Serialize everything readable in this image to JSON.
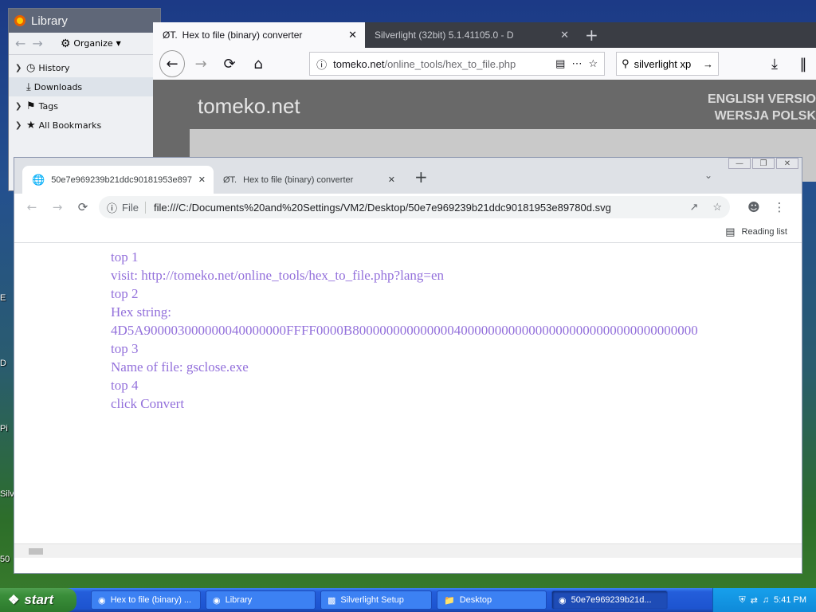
{
  "desktop": {
    "fragments": [
      "E",
      "D",
      "Pi",
      "Silv",
      "50"
    ]
  },
  "library_window": {
    "title": "Library",
    "toolbar": {
      "organize_label": "Organize"
    },
    "tree": [
      {
        "label": "History"
      },
      {
        "label": "Downloads"
      },
      {
        "label": "Tags"
      },
      {
        "label": "All Bookmarks"
      }
    ]
  },
  "firefox_window": {
    "tabs": [
      {
        "label": "Hex to file (binary) converter",
        "favicon": "ØT."
      },
      {
        "label": "Silverlight (32bit) 5.1.41105.0 - D"
      }
    ],
    "url": {
      "domain": "tomeko.net",
      "path": "/online_tools/hex_to_file.php"
    },
    "search_value": "silverlight xp",
    "page": {
      "logo": "tomeko.net",
      "lang_english": "ENGLISH VERSIO",
      "lang_polish": "WERSJA POLSK"
    }
  },
  "chrome_window": {
    "tabs": [
      {
        "label": "50e7e969239b21ddc90181953e8978"
      },
      {
        "label": "Hex to file (binary) converter",
        "favicon": "ØT."
      }
    ],
    "omnibox": {
      "scheme_label": "File",
      "url": "file:///C:/Documents%20and%20Settings/VM2/Desktop/50e7e969239b21ddc90181953e89780d.svg"
    },
    "reading_list_label": "Reading list",
    "content_lines": [
      "top 1",
      "visit: http://tomeko.net/online_tools/hex_to_file.php?lang=en",
      "top 2",
      "Hex string:",
      "4D5A900003000000040000000FFFF0000B800000000000000400000000000000000000000000000000000",
      "top 3",
      "Name of file: gsclose.exe",
      "top 4",
      "click Convert"
    ],
    "text_color": "#9370db"
  },
  "taskbar": {
    "start_label": "start",
    "items": [
      {
        "label": "Hex to file (binary) ..."
      },
      {
        "label": "Library"
      },
      {
        "label": "Silverlight Setup"
      },
      {
        "label": "Desktop"
      },
      {
        "label": "50e7e969239b21d..."
      }
    ],
    "clock": "5:41 PM"
  }
}
